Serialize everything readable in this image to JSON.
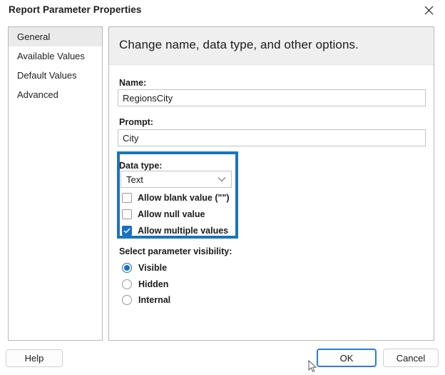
{
  "window": {
    "title": "Report Parameter Properties",
    "close_icon": "close-icon"
  },
  "sidebar": {
    "items": [
      {
        "label": "General",
        "selected": true
      },
      {
        "label": "Available Values",
        "selected": false
      },
      {
        "label": "Default Values",
        "selected": false
      },
      {
        "label": "Advanced",
        "selected": false
      }
    ]
  },
  "content": {
    "heading": "Change name, data type, and other options.",
    "name_field": {
      "label": "Name:",
      "value": "RegionsCity",
      "placeholder": ""
    },
    "prompt_field": {
      "label": "Prompt:",
      "value": "City",
      "placeholder": ""
    },
    "data_type": {
      "label": "Data type:",
      "selected": "Text",
      "chevron_icon": "chevron-down-icon",
      "highlight_color": "#1b75bb",
      "options": [
        {
          "label": "Allow blank value (\"\")",
          "checked": false
        },
        {
          "label": "Allow null value",
          "checked": false
        },
        {
          "label": "Allow multiple values",
          "checked": true
        }
      ]
    },
    "visibility": {
      "label": "Select parameter visibility:",
      "options": [
        {
          "label": "Visible",
          "selected": true
        },
        {
          "label": "Hidden",
          "selected": false
        },
        {
          "label": "Internal",
          "selected": false
        }
      ]
    }
  },
  "footer": {
    "help_label": "Help",
    "ok_label": "OK",
    "cancel_label": "Cancel"
  },
  "accent_color": "#1a6fc4"
}
